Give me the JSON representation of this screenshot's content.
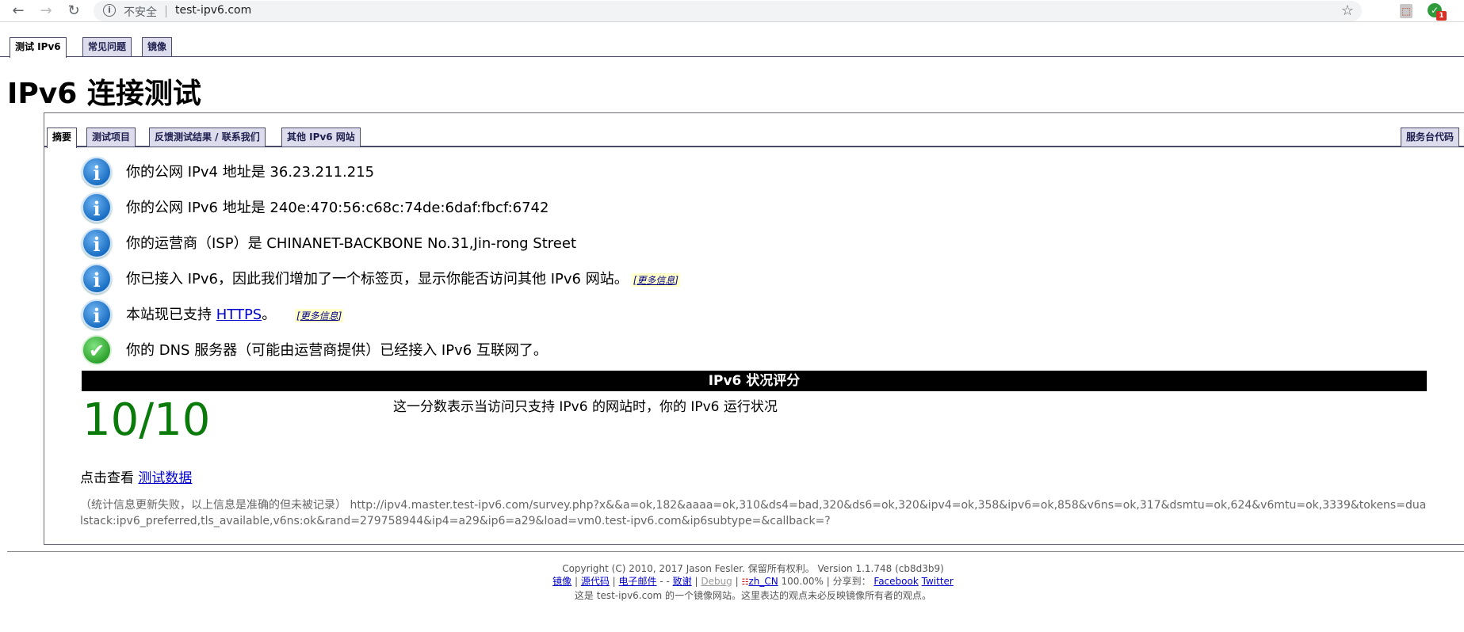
{
  "browser": {
    "insecure_label": "不安全",
    "url": "test-ipv6.com"
  },
  "top_tabs": [
    {
      "label": "测试 IPv6"
    },
    {
      "label": "常见问题"
    },
    {
      "label": "镜像"
    }
  ],
  "page_title": "IPv6 连接测试",
  "sub_tabs": [
    {
      "label": "摘要"
    },
    {
      "label": "测试项目"
    },
    {
      "label": "反馈测试结果 / 联系我们"
    },
    {
      "label": "其他 IPv6 网站"
    }
  ],
  "service_tab_label": "服务台代码",
  "info": {
    "ipv4": "你的公网 IPv4 地址是 36.23.211.215",
    "ipv6": "你的公网 IPv6 地址是 240e:470:56:c68c:74de:6daf:fbcf:6742",
    "isp": "你的运营商（ISP）是 CHINANET-BACKBONE No.31,Jin-rong Street",
    "tab_added": "你已接入 IPv6，因此我们增加了一个标签页，显示你能否访问其他 IPv6 网站。",
    "https_prefix": "本站现已支持 ",
    "https_link": "HTTPS",
    "https_suffix": "。",
    "dns": "你的 DNS 服务器（可能由运营商提供）已经接入 IPv6 互联网了。",
    "more_info": "更多信息"
  },
  "score": {
    "header": "IPv6 状况评分",
    "value": "10/10",
    "description": "这一分数表示当访问只支持 IPv6 的网站时，你的 IPv6 运行状况"
  },
  "test_data": {
    "prefix": "点击查看 ",
    "link": "测试数据"
  },
  "stats_text": "（统计信息更新失败，以上信息是准确的但未被记录） http://ipv4.master.test-ipv6.com/survey.php?x&&a=ok,182&aaaa=ok,310&ds4=bad,320&ds6=ok,320&ipv4=ok,358&ipv6=ok,858&v6ns=ok,317&dsmtu=ok,624&v6mtu=ok,3339&tokens=dualstack:ipv6_preferred,tls_available,v6ns:ok&rand=279758944&ip4=a29&ip6=a29&load=vm0.test-ipv6.com&ip6subtype=&callback=?",
  "footer": {
    "copyright": "Copyright (C) 2010, 2017 Jason Fesler. 保留所有权利。 Version 1.1.748 (cb8d3b9)",
    "mirror": "镜像",
    "source": "源代码",
    "email": "电子邮件",
    "email_suffix": " -  - ",
    "thanks": "致谢",
    "debug": "Debug",
    "locale": "zh_CN",
    "locale_pct": " 100.00% | 分享到： ",
    "facebook": "Facebook",
    "twitter": "Twitter",
    "mirror_note": "这是 test-ipv6.com 的一个镜像网站。这里表达的观点未必反映镜像所有者的观点。"
  }
}
